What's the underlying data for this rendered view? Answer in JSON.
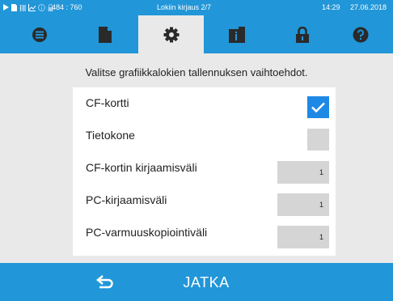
{
  "status_bar": {
    "icons": [
      "play-icon",
      "document-small-icon",
      "steam-icon",
      "chart-icon",
      "info-icon",
      "lock-small-icon"
    ],
    "coordinates": "484 : 760",
    "title": "Lokiin kirjaus 2/7",
    "time": "14:29",
    "date": "27.06.2018"
  },
  "tabs": [
    {
      "icon": "list-icon",
      "active": false
    },
    {
      "icon": "document-icon",
      "active": false
    },
    {
      "icon": "gear-icon",
      "active": true
    },
    {
      "icon": "info-book-icon",
      "active": false
    },
    {
      "icon": "lock-icon",
      "active": false
    },
    {
      "icon": "help-icon",
      "active": false
    }
  ],
  "content": {
    "instruction": "Valitse grafiikkalokien tallennuksen vaihtoehdot."
  },
  "options": [
    {
      "label": "CF-kortti",
      "type": "checkbox",
      "checked": true
    },
    {
      "label": "Tietokone",
      "type": "checkbox",
      "checked": false
    },
    {
      "label": "CF-kortin kirjaamisväli",
      "type": "number",
      "value": "1"
    },
    {
      "label": "PC-kirjaamisväli",
      "type": "number",
      "value": "1"
    },
    {
      "label": "PC-varmuuskopiointiväli",
      "type": "number",
      "value": "1"
    }
  ],
  "footer": {
    "back_icon": "back-arrow-icon",
    "continue_label": "JATKA"
  },
  "colors": {
    "accent": "#2196d8",
    "background": "#e9e9e9",
    "checkbox_checked": "#1e88e5",
    "field": "#d5d5d5"
  }
}
